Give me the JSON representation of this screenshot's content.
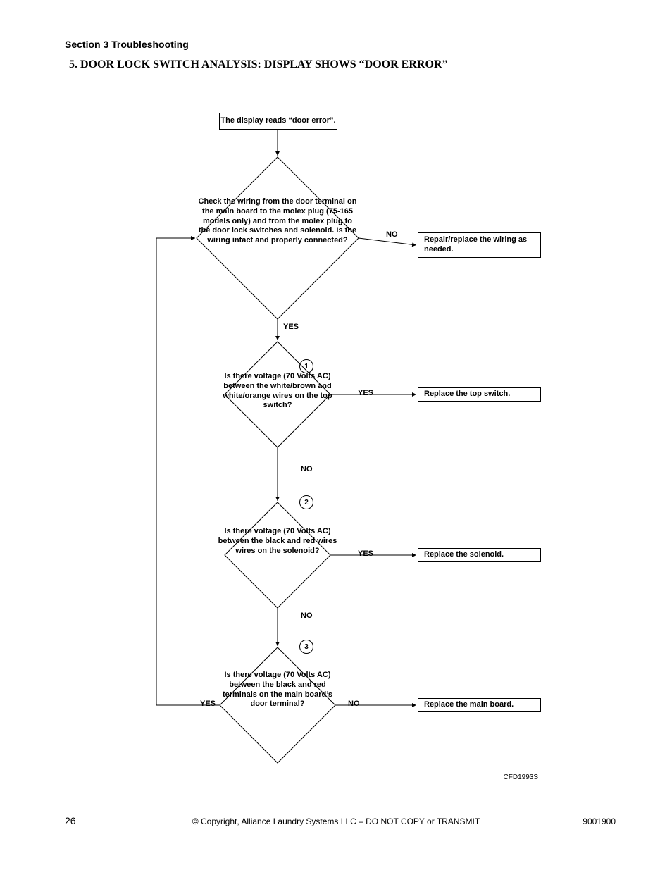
{
  "section_header": "Section 3 Troubleshooting",
  "title": "5. DOOR LOCK SWITCH ANALYSIS: DISPLAY SHOWS “DOOR ERROR”",
  "flow": {
    "start": "The display reads “door error”.",
    "decision1": "Check the wiring from the door terminal on the main board to the molex plug (75-165 models only) and from the molex plug to the door lock switches and solenoid. Is the wiring intact and properly connected?",
    "decision2": "Is there voltage (70 Volts AC) between the white/brown and white/orange wires on the top switch?",
    "decision3": "Is there voltage  (70 Volts AC) between the black and red wires wires on the solenoid?",
    "decision4": "Is there voltage  (70 Volts AC) between the black and red terminals on the main board’s door terminal?",
    "action1": "Repair/replace the wiring as needed.",
    "action2": "Replace the top switch.",
    "action3": "Replace the solenoid.",
    "action4": "Replace the main board.",
    "labels": {
      "yes": "YES",
      "no": "NO"
    },
    "step_nums": {
      "n1": "1",
      "n2": "2",
      "n3": "3"
    }
  },
  "figure_id": "CFD1993S",
  "footer": {
    "page": "26",
    "center": "© Copyright, Alliance Laundry Systems LLC – DO NOT COPY or TRANSMIT",
    "right": "9001900"
  }
}
